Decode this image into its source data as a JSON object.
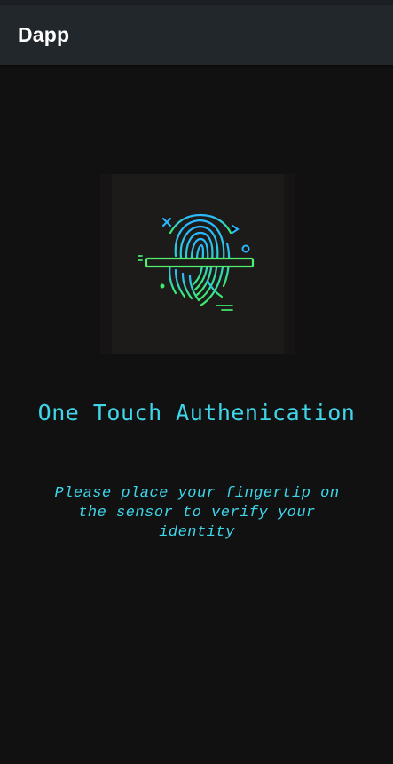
{
  "app_bar": {
    "title": "Dapp"
  },
  "fingerprint_icon": {
    "name": "fingerprint-scan-icon",
    "colors": {
      "gradient_top": "#2ab8ff",
      "gradient_bottom": "#3ee86a",
      "scan_bar": "#4ff070"
    }
  },
  "main": {
    "headline": "One Touch Authenication",
    "instruction": "Please place your fingertip on the sensor to verify your identity"
  },
  "colors": {
    "background": "#111111",
    "app_bar": "#22272c",
    "accent_text": "#3fd6ea"
  }
}
